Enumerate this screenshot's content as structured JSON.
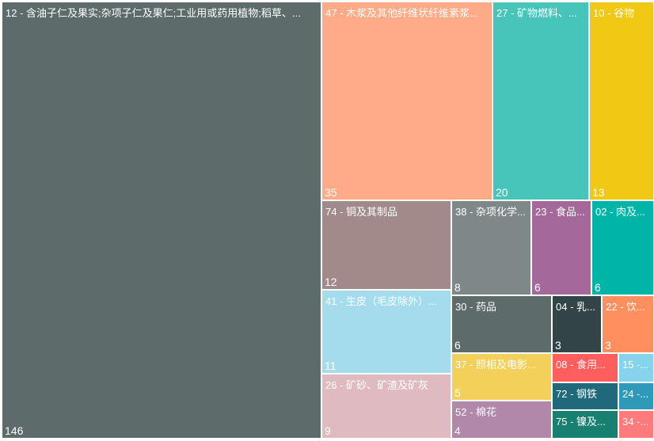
{
  "chart_data": {
    "type": "treemap",
    "items": [
      {
        "label": "12 - 含油子仁及果实;杂项子仁及果仁;工业用或药用植物;稻草、...",
        "value": 146,
        "color": "#5d6b6b"
      },
      {
        "label": "47 - 木浆及其他纤维状纤维素浆...",
        "value": 35,
        "color": "#ffab87"
      },
      {
        "label": "27 - 矿物燃料、...",
        "value": 20,
        "color": "#48c5bb"
      },
      {
        "label": "10 - 谷物",
        "value": 13,
        "color": "#f1c814"
      },
      {
        "label": "74 - 铜及其制品",
        "value": 12,
        "color": "#a28a8a"
      },
      {
        "label": "41 - 生皮（毛皮除外）...",
        "value": 11,
        "color": "#a4dced"
      },
      {
        "label": "26 - 矿砂、矿渣及矿灰",
        "value": 9,
        "color": "#dfbbc1"
      },
      {
        "label": "38 - 杂项化学...",
        "value": 8,
        "color": "#7f8888"
      },
      {
        "label": "23 - 食品...",
        "value": 6,
        "color": "#a5689b"
      },
      {
        "label": "02 - 肉及...",
        "value": 6,
        "color": "#00b4a8"
      },
      {
        "label": "30 - 药品",
        "value": 6,
        "color": "#5d6b6b"
      },
      {
        "label": "37 - 照相及电影...",
        "value": 5,
        "color": "#f3d059"
      },
      {
        "label": "52 - 棉花",
        "value": 4,
        "color": "#b288aa"
      },
      {
        "label": "04 - 乳...",
        "value": 3,
        "color": "#324445"
      },
      {
        "label": "22 - 饮...",
        "value": 3,
        "color": "#ff8f5f"
      },
      {
        "label": "08 - 食用...",
        "value": 2,
        "color": "#ff5e5e"
      },
      {
        "label": "15 -...",
        "value": 1,
        "color": "#85d4ec"
      },
      {
        "label": "72 - 钢铁",
        "value": 2,
        "color": "#20697b"
      },
      {
        "label": "24 -...",
        "value": 1,
        "color": "#2e99b8"
      },
      {
        "label": "75 - 镍及...",
        "value": 2,
        "color": "#188071"
      },
      {
        "label": "34 -...",
        "value": 1,
        "color": "#ff7a7a"
      }
    ]
  }
}
